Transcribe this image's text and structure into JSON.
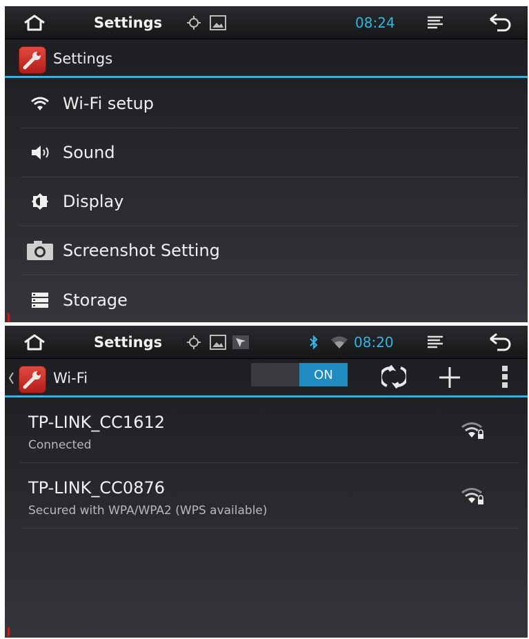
{
  "screen1": {
    "status": {
      "title": "Settings",
      "time": "08:24"
    },
    "app_title": "Settings",
    "items": [
      {
        "label": "Wi-Fi setup",
        "icon": "wifi-icon"
      },
      {
        "label": "Sound",
        "icon": "speaker-icon"
      },
      {
        "label": "Display",
        "icon": "brightness-icon"
      },
      {
        "label": "Screenshot Setting",
        "icon": "camera-icon"
      },
      {
        "label": "Storage",
        "icon": "storage-icon"
      }
    ]
  },
  "screen2": {
    "status": {
      "title": "Settings",
      "time": "08:20"
    },
    "app_title": "Wi-Fi",
    "toggle_label": "ON",
    "networks": [
      {
        "name": "TP-LINK_CC1612",
        "status": "Connected"
      },
      {
        "name": "TP-LINK_CC0876",
        "status": "Secured with WPA/WPA2 (WPS available)"
      }
    ]
  },
  "colors": {
    "accent": "#33b5e5",
    "toggle_on": "#1f8bc0",
    "app_icon": "#d33a32"
  }
}
